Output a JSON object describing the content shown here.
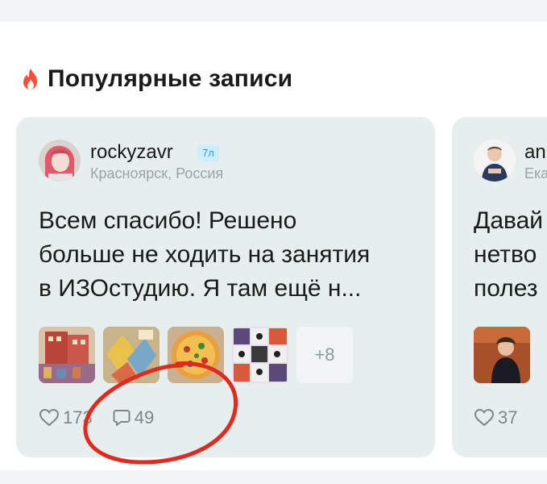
{
  "section": {
    "title": "Популярные записи",
    "icon": "fire-icon",
    "accent": "#ff4d3a"
  },
  "posts": [
    {
      "username": "rockyzavr",
      "badge": "7л",
      "location": "Красноярск, Россия",
      "text_lines": [
        "Всем спасибо! Решено",
        "больше не ходить на занятия",
        "в ИЗОстудию.   Я там ещё н..."
      ],
      "more_images": "+8",
      "likes": "173",
      "comments": "49"
    },
    {
      "username": "an",
      "location": "Ека",
      "text_lines": [
        "Давай",
        "нетво",
        "полез"
      ],
      "likes": "37"
    }
  ],
  "colors": {
    "card_bg": "#e6efee",
    "badge_bg": "#cdeeff",
    "badge_text": "#2a9fd8",
    "annotation": "#e0291f"
  }
}
